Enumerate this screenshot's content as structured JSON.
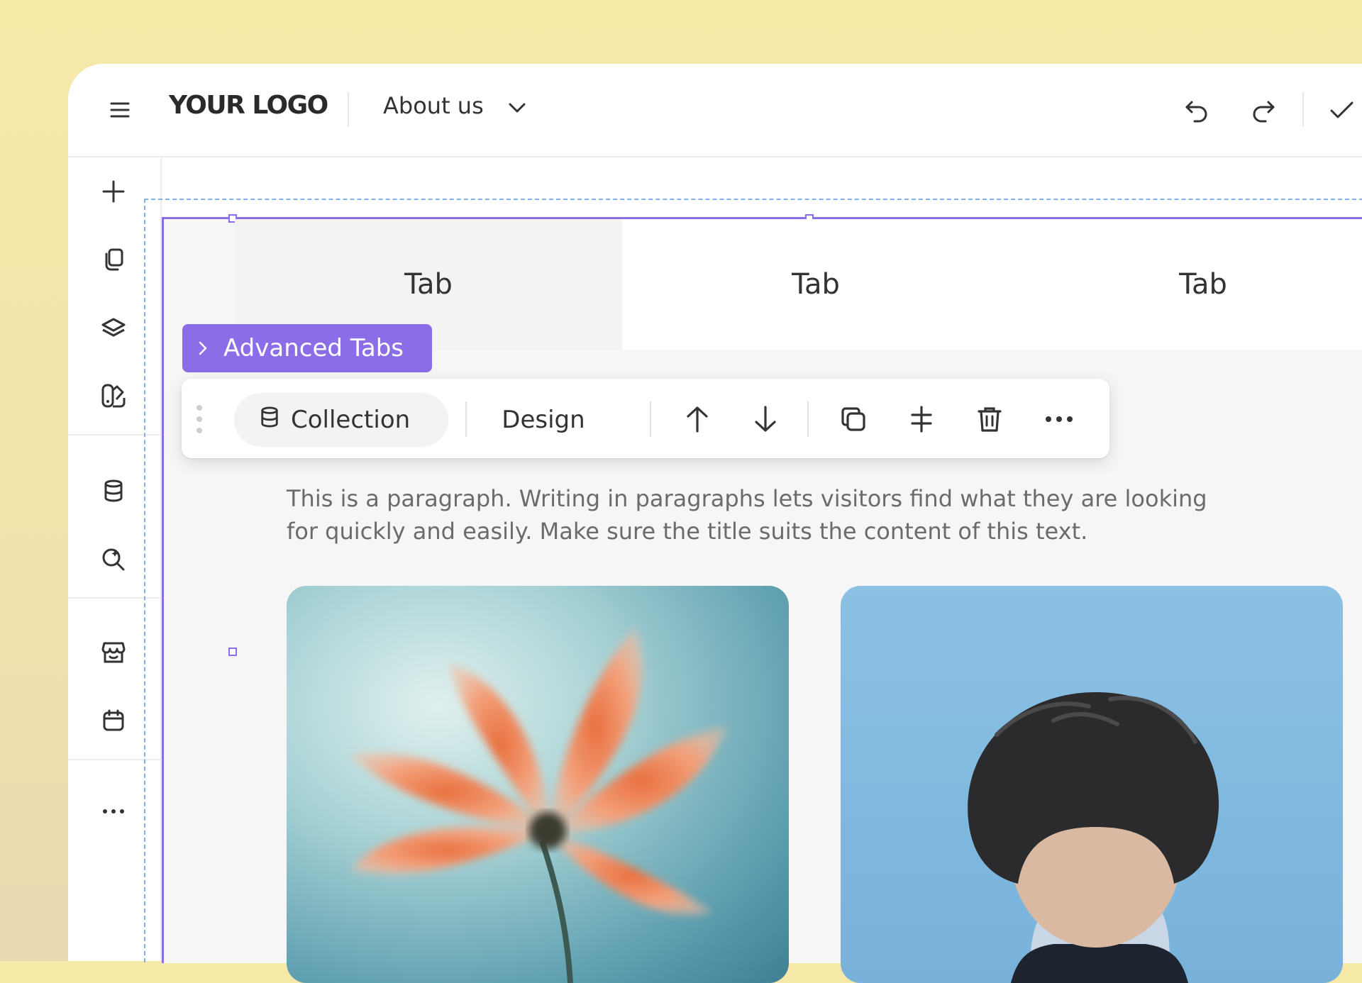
{
  "header": {
    "logo": "YOUR LOGO",
    "page_selector": "About us"
  },
  "tabs": [
    {
      "label": "Tab",
      "active": true
    },
    {
      "label": "Tab",
      "active": false
    },
    {
      "label": "Tab",
      "active": false
    }
  ],
  "element_label": "Advanced Tabs",
  "toolbar": {
    "collection_label": "Collection",
    "design_label": "Design"
  },
  "content": {
    "paragraph": "This is a paragraph. Writing in paragraphs lets visitors find what they are looking for quickly and easily. Make sure the title suits the content of this text."
  },
  "sidebar_icons": [
    "plus-icon",
    "pages-icon",
    "layers-icon",
    "theme-icon",
    "database-icon",
    "search-sparkle-icon",
    "store-icon",
    "calendar-icon",
    "more-icon"
  ],
  "colors": {
    "accent": "#8b6de8",
    "selection_dashed": "#7fb0e6"
  }
}
